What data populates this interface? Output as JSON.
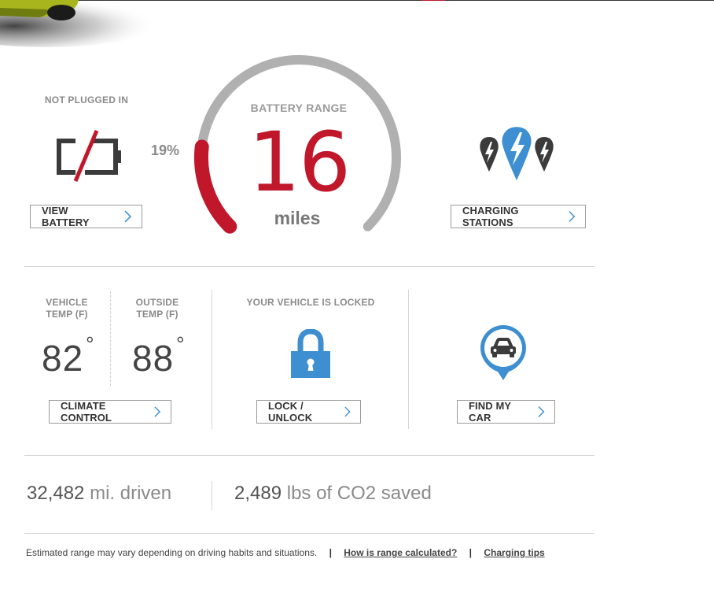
{
  "battery": {
    "status": "NOT PLUGGED IN",
    "view_label": "VIEW BATTERY",
    "percent": "19%",
    "percent_value": 19,
    "range_title": "BATTERY RANGE",
    "range_value": "16",
    "range_unit": "miles"
  },
  "charging": {
    "label": "CHARGING STATIONS"
  },
  "temps": {
    "vehicle_label_1": "VEHICLE",
    "vehicle_label_2": "TEMP (F)",
    "vehicle_value": "82",
    "outside_label_1": "OUTSIDE",
    "outside_label_2": "TEMP (F)",
    "outside_value": "88",
    "degree_symbol": "°",
    "climate_label": "CLIMATE CONTROL"
  },
  "lock": {
    "status": "YOUR VEHICLE IS LOCKED",
    "button_label": "LOCK / UNLOCK"
  },
  "find": {
    "button_label": "FIND MY CAR"
  },
  "stats": {
    "miles_value": "32,482",
    "miles_unit": "mi. driven",
    "co2_value": "2,489",
    "co2_unit": "lbs of CO2 saved"
  },
  "footer": {
    "disclaimer": "Estimated range may vary depending on driving habits and situations.",
    "separator": "|",
    "link_range": "How is range calculated?",
    "link_tips": "Charging tips"
  },
  "colors": {
    "accent_red": "#c0172b",
    "accent_blue": "#3d8fd1",
    "gauge_grey": "#b0b0b0"
  }
}
